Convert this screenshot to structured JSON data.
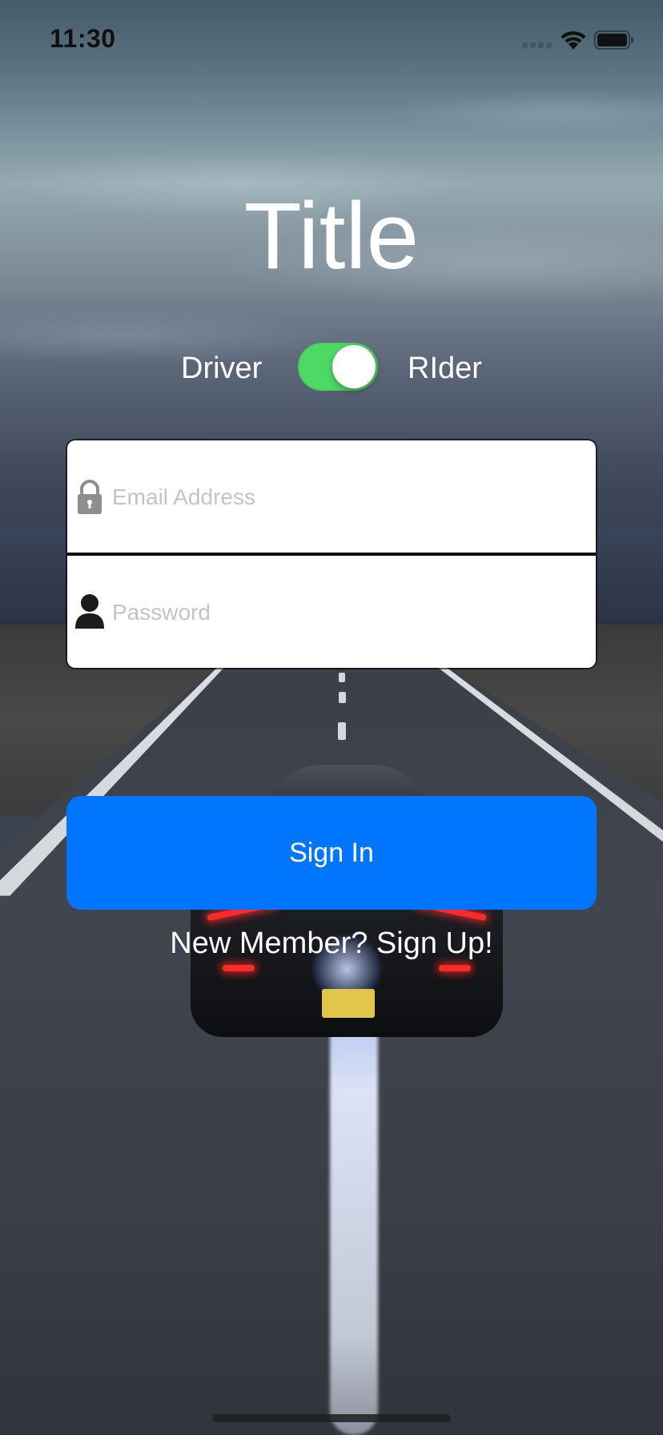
{
  "status_bar": {
    "time": "11:30"
  },
  "title": "Title",
  "role_toggle": {
    "left_label": "Driver",
    "right_label": "RIder",
    "is_on": true,
    "on_color": "#4cd964"
  },
  "form": {
    "email": {
      "placeholder": "Email Address",
      "value": "",
      "icon": "lock-icon"
    },
    "password": {
      "placeholder": "Password",
      "value": "",
      "icon": "person-icon"
    }
  },
  "sign_in": {
    "label": "Sign In",
    "color": "#0076ff"
  },
  "sign_up_link": "New Member? Sign Up!"
}
